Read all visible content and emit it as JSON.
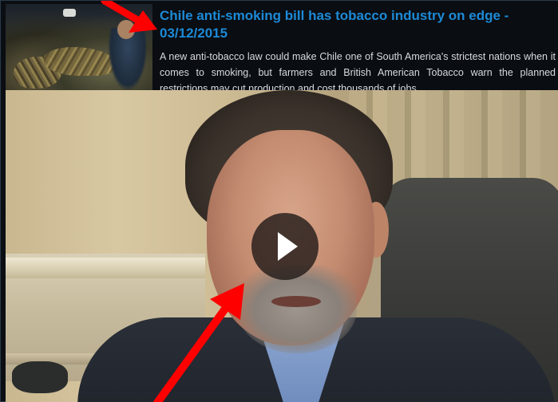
{
  "article": {
    "title": "Chile anti-smoking bill has tobacco industry on edge - 03/12/2015",
    "description": "A new anti-tobacco law could make Chile one of South America's strictest nations when it comes to smoking, but farmers and British American Tobacco warn the planned restrictions may cut production and cost thousands of jobs."
  },
  "video": {
    "play_icon": "play-icon"
  },
  "colors": {
    "title": "#1d8ad6",
    "background": "#0a0d12",
    "annotation_arrow": "#ff0000"
  }
}
